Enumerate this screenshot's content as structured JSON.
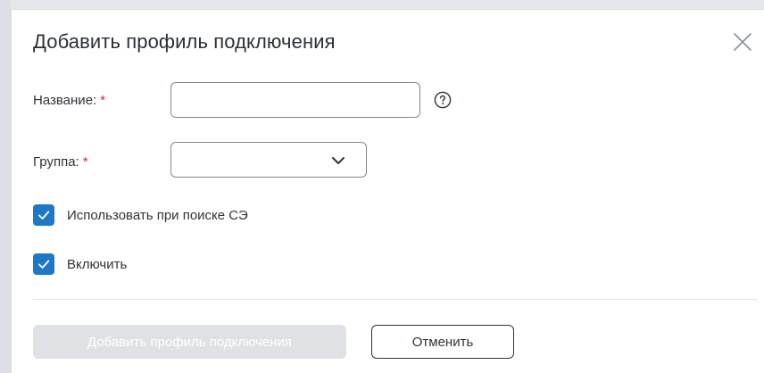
{
  "dialog": {
    "title": "Добавить профиль подключения",
    "close_icon": "close-icon"
  },
  "form": {
    "name": {
      "label": "Название:",
      "required_mark": "*",
      "value": "",
      "help_icon": "question-circle-icon"
    },
    "group": {
      "label": "Группа:",
      "required_mark": "*",
      "selected": "",
      "dropdown_icon": "chevron-down-icon"
    },
    "checkboxes": [
      {
        "label": "Использовать при поиске СЭ",
        "checked": true
      },
      {
        "label": "Включить",
        "checked": true
      }
    ]
  },
  "footer": {
    "submit_label": "Добавить профиль подключения",
    "submit_disabled": true,
    "cancel_label": "Отменить"
  },
  "colors": {
    "accent": "#1e78c8",
    "required": "#d9283a",
    "disabled_button": "#dfe1e4",
    "text": "#2f3338"
  }
}
